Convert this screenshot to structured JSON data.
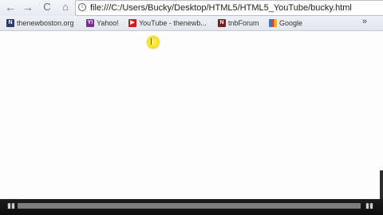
{
  "toolbar": {
    "back_glyph": "←",
    "forward_glyph": "→",
    "reload_glyph": "C",
    "home_glyph": "⌂",
    "url": "file:///C:/Users/Bucky/Desktop/HTML5/HTML5_YouTube/bucky.html",
    "page_icon_glyph": "i"
  },
  "bookmarks": {
    "items": [
      {
        "label": "thenewboston.org",
        "icon_glyph": "N",
        "icon": "thenewboston-favicon"
      },
      {
        "label": "Yahoo!",
        "icon_glyph": "Y!",
        "icon": "yahoo-favicon"
      },
      {
        "label": "YouTube - thenewb...",
        "icon_glyph": "▶",
        "icon": "youtube-favicon"
      },
      {
        "label": "tnbForum",
        "icon_glyph": "N",
        "icon": "tnbforum-favicon"
      },
      {
        "label": "Google",
        "icon_glyph": "",
        "icon": "google-favicon"
      }
    ],
    "overflow_glyph": "»"
  },
  "player": {
    "play_glyph": "▮▮",
    "volume_glyph": "▮▮"
  },
  "colors": {
    "page_background": "#fdfdfe",
    "player_bar": "#111111",
    "cursor_highlight": "#f0d200"
  }
}
